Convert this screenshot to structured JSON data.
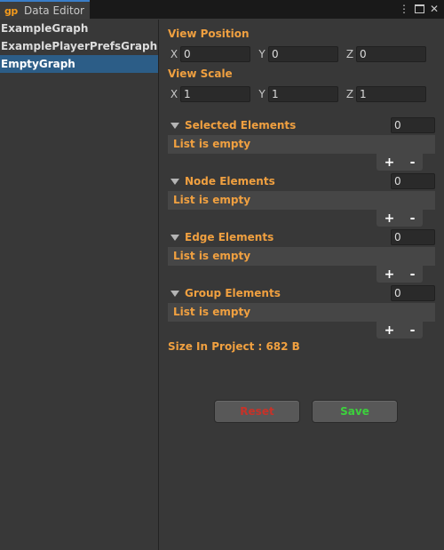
{
  "window": {
    "tab_title": "Data Editor",
    "logo_text": "gp",
    "menu_icon": "⋮"
  },
  "sidebar": {
    "items": [
      {
        "label": "ExampleGraph",
        "selected": false
      },
      {
        "label": "ExamplePlayerPrefsGraph",
        "selected": false
      },
      {
        "label": "EmptyGraph",
        "selected": true
      }
    ]
  },
  "view_position": {
    "label": "View Position",
    "x_label": "X",
    "x": "0",
    "y_label": "Y",
    "y": "0",
    "z_label": "Z",
    "z": "0"
  },
  "view_scale": {
    "label": "View Scale",
    "x_label": "X",
    "x": "1",
    "y_label": "Y",
    "y": "1",
    "z_label": "Z",
    "z": "1"
  },
  "lists": [
    {
      "label": "Selected Elements",
      "count": "0",
      "empty_text": "List is empty",
      "add": "+",
      "remove": "-"
    },
    {
      "label": "Node Elements",
      "count": "0",
      "empty_text": "List is empty",
      "add": "+",
      "remove": "-"
    },
    {
      "label": "Edge Elements",
      "count": "0",
      "empty_text": "List is empty",
      "add": "+",
      "remove": "-"
    },
    {
      "label": "Group Elements",
      "count": "0",
      "empty_text": "List is empty",
      "add": "+",
      "remove": "-"
    }
  ],
  "size_info": "Size In Project : 682 B",
  "buttons": {
    "reset": "Reset",
    "save": "Save"
  },
  "colors": {
    "accent_orange": "#f0a040",
    "selection_blue": "#2c5d87",
    "reset_red": "#c83228",
    "save_green": "#3cd23c",
    "logo_orange": "#f39a1c"
  }
}
